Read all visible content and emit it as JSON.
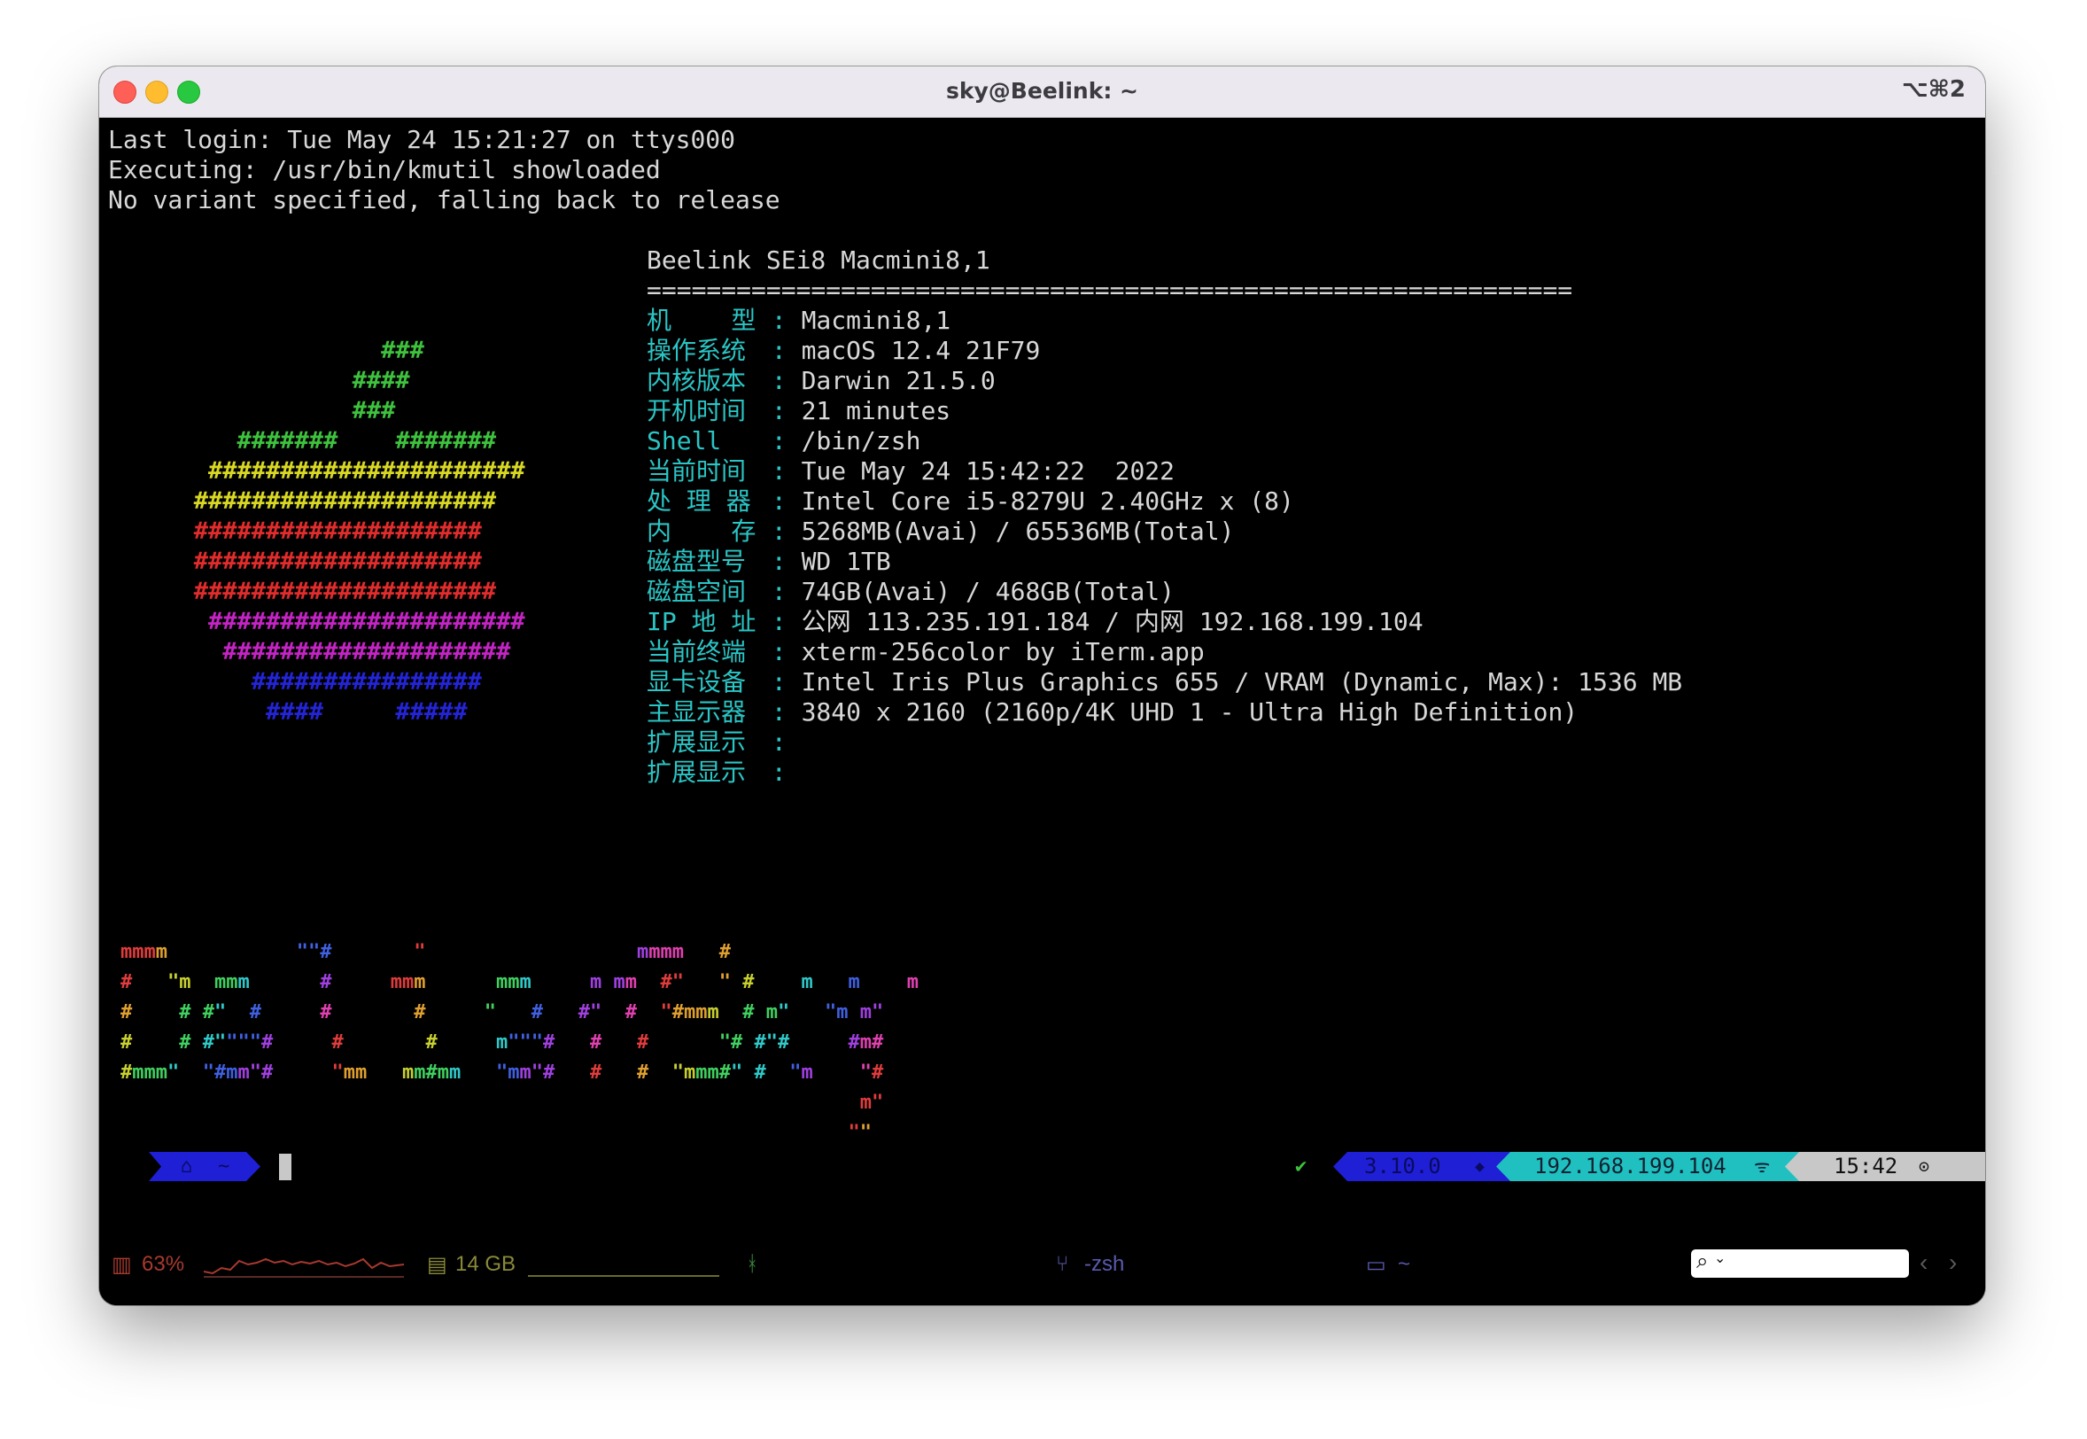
{
  "window": {
    "title": "sky@Beelink: ~",
    "shortcut": "⌥⌘2"
  },
  "terminal": {
    "header_lines": [
      "Last login: Tue May 24 15:21:27 on ttys000",
      "Executing: /usr/bin/kmutil showloaded",
      "No variant specified, falling back to release"
    ],
    "machine_title": "Beelink SEi8 Macmini8,1",
    "separator": "==============================================================",
    "info": [
      {
        "key": "机    型",
        "value": "Macmini8,1"
      },
      {
        "key": "操作系统",
        "value": "macOS 12.4 21F79"
      },
      {
        "key": "内核版本",
        "value": "Darwin 21.5.0"
      },
      {
        "key": "开机时间",
        "value": "21 minutes"
      },
      {
        "key": "Shell",
        "value": "/bin/zsh"
      },
      {
        "key": "当前时间",
        "value": "Tue May 24 15:42:22  2022"
      },
      {
        "key": "处 理 器",
        "value": "Intel Core i5-8279U 2.40GHz x (8)"
      },
      {
        "key": "内    存",
        "value": "5268MB(Avai) / 65536MB(Total)"
      },
      {
        "key": "磁盘型号",
        "value": "WD 1TB"
      },
      {
        "key": "磁盘空间",
        "value": "74GB(Avai) / 468GB(Total)"
      },
      {
        "key": "IP 地 址",
        "value": "公网 113.235.191.184 / 内网 192.168.199.104"
      },
      {
        "key": "当前终端",
        "value": "xterm-256color by iTerm.app"
      },
      {
        "key": "显卡设备",
        "value": "Intel Iris Plus Graphics 655 / VRAM (Dynamic, Max): 1536 MB"
      },
      {
        "key": "主显示器",
        "value": "3840 x 2160 (2160p/4K UHD 1 - Ultra High Definition)"
      },
      {
        "key": "扩展显示",
        "value": ""
      },
      {
        "key": "扩展显示",
        "value": ""
      }
    ],
    "apple_logo": [
      {
        "text": "                ###",
        "color": "#3ec23e"
      },
      {
        "text": "              ####",
        "color": "#3ec23e"
      },
      {
        "text": "              ###",
        "color": "#3ec23e"
      },
      {
        "text": "      #######    #######",
        "color": "#3ec23e"
      },
      {
        "text": "    ######################",
        "color": "#d8d824"
      },
      {
        "text": "   #####################",
        "color": "#d8d824"
      },
      {
        "text": "   ####################",
        "color": "#e02c2c"
      },
      {
        "text": "   ####################",
        "color": "#e02c2c"
      },
      {
        "text": "   #####################",
        "color": "#e02c2c"
      },
      {
        "text": "    ######################",
        "color": "#c424c4"
      },
      {
        "text": "     ####################",
        "color": "#c424c4"
      },
      {
        "text": "       ################",
        "color": "#2424d8"
      },
      {
        "text": "        ####     #####",
        "color": "#2424d8"
      }
    ],
    "banner_lines": [
      "mmmm           \"\"#       \"                  mmmm   #",
      "#   \"m  mmm      #     mmm      mmm     m mm  #\"   \" #    m   m    m",
      "#    # #\"  #     #       #     \"   #   #\"  #  \"#mmm  # m\"   \"m m\"",
      "#    # #\"\"\"\"#     #       #     m\"\"\"#   #   #      \"# #\"#     #m#",
      "#mmm\"  \"#mm\"#     \"mm   mm#mm   \"mm\"#   #   #  \"mmm#\" #  \"m    \"#",
      "                                                               m\"",
      "                                                              \"\""
    ],
    "banner_colors": [
      "#e03c3c",
      "#e0a030",
      "#c8d030",
      "#40d060",
      "#30c8c8",
      "#4060e0",
      "#a040e0",
      "#e040b0"
    ]
  },
  "prompt": {
    "apple_glyph": "",
    "home_glyph": "⌂",
    "branch_glyph": "~",
    "check_glyph": "✔",
    "python_version": "3.10.0",
    "ip": "192.168.199.104",
    "wifi_glyph": "ᯤ",
    "time": "15:42",
    "clock_glyph": "⊙",
    "colors": {
      "blue": "#1f1fd6",
      "cyan": "#20c0c0",
      "gray": "#c8c8c8"
    }
  },
  "statusbar": {
    "cpu_icon": "▥",
    "cpu": "63%",
    "mem_icon": "▤",
    "mem": "14 GB",
    "git_icon": "ᚼ",
    "session": "-zsh",
    "session_icon": "⑂",
    "folder_icon": "▭",
    "folder": "~",
    "search_icon": "⌕",
    "nav_prev": "‹",
    "nav_next": "›"
  }
}
